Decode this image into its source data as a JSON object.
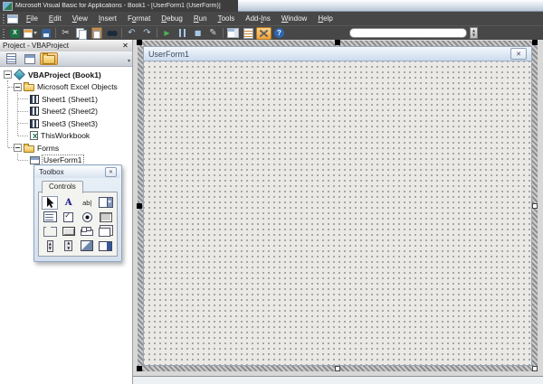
{
  "window": {
    "title": "Microsoft Visual Basic for Applications - Book1 - [UserForm1 (UserForm)]"
  },
  "menu": {
    "items": [
      {
        "label": "File",
        "mnemonic_index": 0
      },
      {
        "label": "Edit",
        "mnemonic_index": 0
      },
      {
        "label": "View",
        "mnemonic_index": 0
      },
      {
        "label": "Insert",
        "mnemonic_index": 0
      },
      {
        "label": "Format",
        "mnemonic_index": 1
      },
      {
        "label": "Debug",
        "mnemonic_index": 0
      },
      {
        "label": "Run",
        "mnemonic_index": 0
      },
      {
        "label": "Tools",
        "mnemonic_index": 0
      },
      {
        "label": "Add-Ins",
        "mnemonic_index": 4
      },
      {
        "label": "Window",
        "mnemonic_index": 0
      },
      {
        "label": "Help",
        "mnemonic_index": 0
      }
    ]
  },
  "toolbar": {
    "buttons": [
      {
        "name": "view-excel-icon"
      },
      {
        "name": "insert-userform-icon"
      },
      {
        "name": "save-icon"
      },
      {
        "separator": true
      },
      {
        "name": "cut-icon"
      },
      {
        "name": "copy-icon"
      },
      {
        "name": "paste-icon"
      },
      {
        "name": "find-icon"
      },
      {
        "separator": true
      },
      {
        "name": "undo-icon"
      },
      {
        "name": "redo-icon"
      },
      {
        "separator": true
      },
      {
        "name": "run-icon"
      },
      {
        "name": "break-icon"
      },
      {
        "name": "reset-icon"
      },
      {
        "name": "design-mode-icon"
      },
      {
        "separator": true
      },
      {
        "name": "project-explorer-icon"
      },
      {
        "name": "properties-window-icon"
      },
      {
        "name": "toolbox-icon",
        "active": true
      },
      {
        "name": "help-icon"
      }
    ]
  },
  "project_explorer": {
    "title": "Project - VBAProject",
    "buttons": [
      {
        "name": "view-code-button",
        "icon": "view-code-icon"
      },
      {
        "name": "view-object-button",
        "icon": "view-object-icon"
      },
      {
        "name": "toggle-folders-button",
        "icon": "toggle-folders-icon",
        "active": true
      }
    ],
    "tree": [
      {
        "label": "VBAProject (Book1)",
        "icon": "project-icon",
        "level": 0,
        "expander": "minus",
        "bold": true
      },
      {
        "label": "Microsoft Excel Objects",
        "icon": "folder-open-icon",
        "level": 1,
        "expander": "minus"
      },
      {
        "label": "Sheet1 (Sheet1)",
        "icon": "worksheet-icon",
        "level": 2
      },
      {
        "label": "Sheet2 (Sheet2)",
        "icon": "worksheet-icon",
        "level": 2
      },
      {
        "label": "Sheet3 (Sheet3)",
        "icon": "worksheet-icon",
        "level": 2
      },
      {
        "label": "ThisWorkbook",
        "icon": "workbook-icon",
        "level": 2
      },
      {
        "label": "Forms",
        "icon": "folder-icon",
        "level": 1,
        "expander": "minus"
      },
      {
        "label": "UserForm1",
        "icon": "userform-icon",
        "level": 2,
        "focused": true
      }
    ]
  },
  "toolbox": {
    "title": "Toolbox",
    "tab_label": "Controls",
    "controls": [
      {
        "name": "select-objects-tool",
        "selected": true
      },
      {
        "name": "label-tool"
      },
      {
        "name": "textbox-tool"
      },
      {
        "name": "combobox-tool"
      },
      {
        "name": "listbox-tool"
      },
      {
        "name": "checkbox-tool"
      },
      {
        "name": "optionbutton-tool"
      },
      {
        "name": "togglebutton-tool"
      },
      {
        "name": "frame-tool"
      },
      {
        "name": "commandbutton-tool"
      },
      {
        "name": "tabstrip-tool"
      },
      {
        "name": "multipage-tool"
      },
      {
        "name": "scrollbar-tool"
      },
      {
        "name": "spinbutton-tool"
      },
      {
        "name": "image-tool"
      },
      {
        "name": "refedit-tool"
      }
    ]
  },
  "designer": {
    "form_title": "UserForm1"
  },
  "colors": {
    "titlebar_dark": "#3d3d3d",
    "menubar_bg": "#474747",
    "active_button_orange": "#eea13f",
    "form_titlebar": "#ccdbee",
    "form_grid_bg": "#ebe9e6",
    "grid_dot": "#8f8f8f"
  }
}
